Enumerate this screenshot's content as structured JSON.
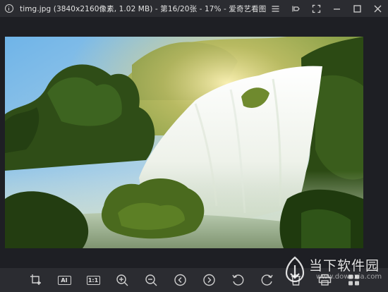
{
  "window": {
    "title": "timg.jpg (3840x2160像素, 1.02 MB) - 第16/20张 - 17% - 爱奇艺看图"
  },
  "window_controls": [
    "menu-icon",
    "pin-icon",
    "fullscreen-icon",
    "minimize-icon",
    "maximize-icon",
    "close-icon"
  ],
  "toolbar": {
    "ai_label": "AI",
    "actual_size_label": "1:1",
    "buttons": [
      "crop-icon",
      "ai-button",
      "actual-size-button",
      "zoom-in-icon",
      "zoom-out-icon",
      "previous-icon",
      "next-icon",
      "rotate-left-icon",
      "rotate-right-icon",
      "delete-icon",
      "print-icon",
      "grid-icon"
    ]
  },
  "watermark": {
    "brand": "当下软件园",
    "domain": "www.downxia.com"
  },
  "colors": {
    "background": "#1e1f24",
    "bar": "#2b2c31",
    "icon": "#cfcfcf"
  }
}
